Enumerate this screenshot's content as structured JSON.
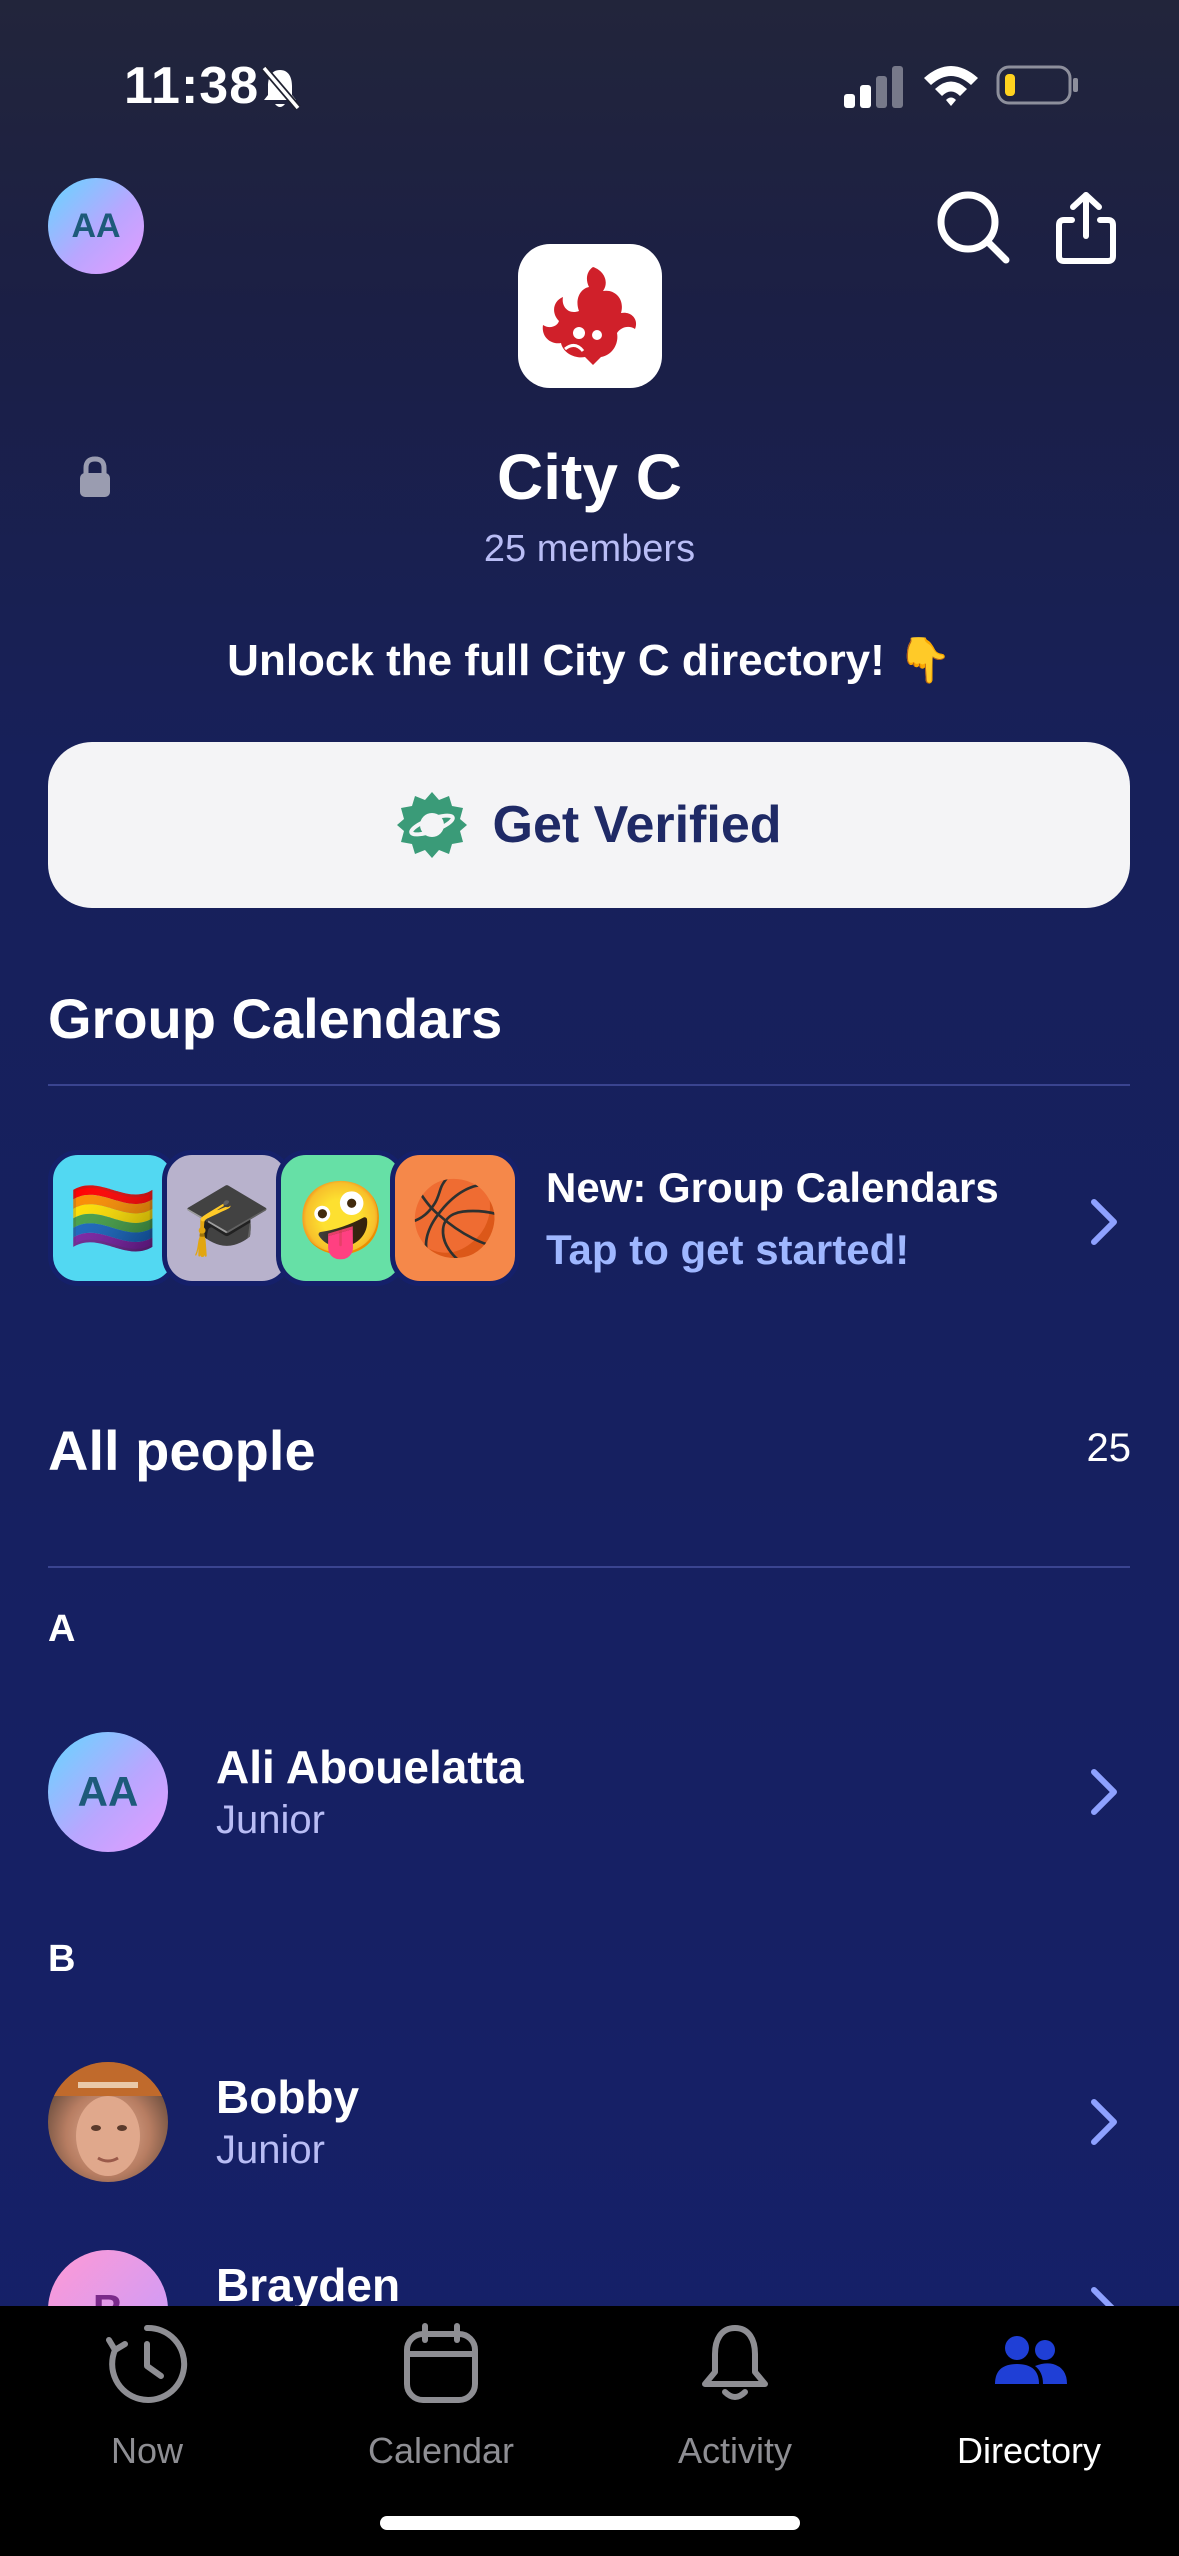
{
  "status_bar": {
    "time": "11:38"
  },
  "header": {
    "avatar_initials": "AA",
    "group_name": "City C",
    "members": "25 members",
    "unlock_text": "Unlock the full City C directory! 👇",
    "verify_label": "Get Verified"
  },
  "group_calendars": {
    "title": "Group Calendars",
    "tiles": [
      {
        "emoji": "🏳️‍🌈",
        "color": "#52d8f2"
      },
      {
        "emoji": "🎓",
        "color": "#b8b2cc"
      },
      {
        "emoji": "🤪",
        "color": "#66e0a6"
      },
      {
        "emoji": "🏀",
        "color": "#f5884a"
      }
    ],
    "promo_title": "New: Group Calendars",
    "promo_sub": "Tap to get started!"
  },
  "people": {
    "title": "All people",
    "count": "25",
    "sections": [
      {
        "letter": "A",
        "items": [
          {
            "initials": "AA",
            "name": "Ali Abouelatta",
            "sub": "Junior"
          }
        ]
      },
      {
        "letter": "B",
        "items": [
          {
            "initials": "",
            "name": "Bobby",
            "sub": "Junior"
          },
          {
            "initials": "B",
            "name": "Brayden",
            "sub": ""
          }
        ]
      }
    ]
  },
  "tabbar": {
    "tabs": [
      {
        "label": "Now",
        "icon": "clock-icon"
      },
      {
        "label": "Calendar",
        "icon": "calendar-icon"
      },
      {
        "label": "Activity",
        "icon": "bell-icon"
      },
      {
        "label": "Directory",
        "icon": "people-icon",
        "active": true
      }
    ]
  },
  "colors": {
    "accent": "#1f3fd6",
    "verified_badge": "#3a9b78",
    "logo_red": "#d0202a"
  }
}
